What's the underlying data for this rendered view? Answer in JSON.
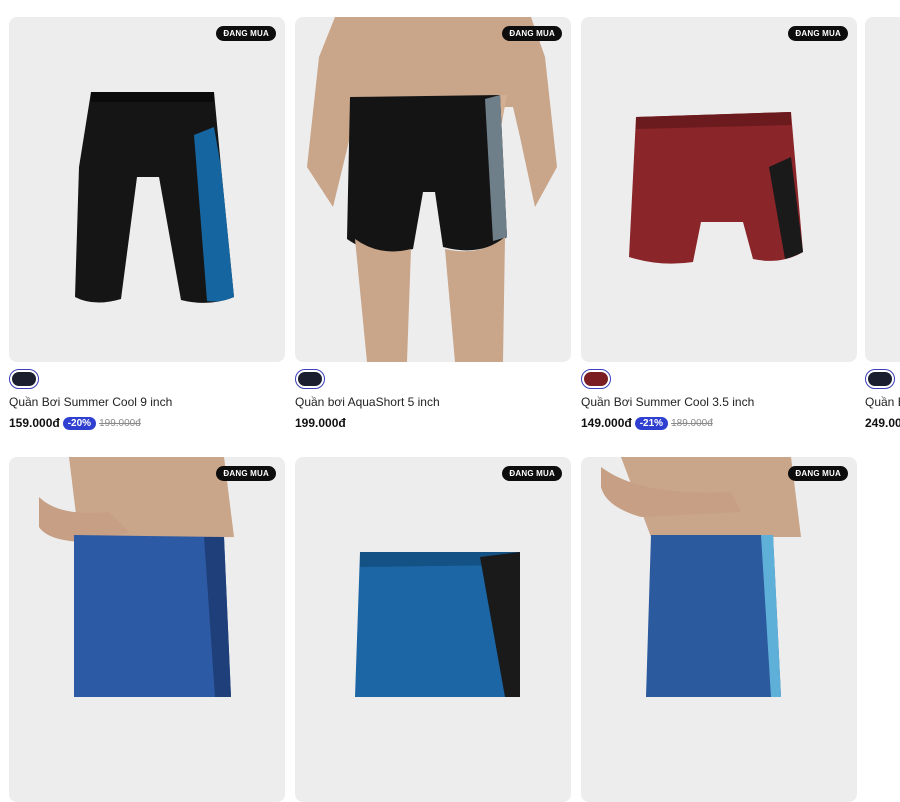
{
  "badge_label": "ĐANG MUA",
  "products": [
    {
      "name": "Quần Bơi Summer Cool 9 inch",
      "price": "159.000đ",
      "discount": "-20%",
      "original_price": "199.000đ",
      "swatch_color": "#1b1e2e",
      "badge": "ĐANG MUA"
    },
    {
      "name": "Quần bơi AquaShort 5 inch",
      "price": "199.000đ",
      "swatch_color": "#1b1e2e",
      "badge": "ĐANG MUA"
    },
    {
      "name": "Quần Bơi Summer Cool 3.5 inch",
      "price": "149.000đ",
      "discount": "-21%",
      "original_price": "189.000đ",
      "swatch_color": "#7a1e22",
      "badge": "ĐANG MUA"
    },
    {
      "name": "Quần B",
      "price": "249.00",
      "swatch_color": "#1b1e2e"
    }
  ],
  "row2_products": [
    {
      "badge": "ĐANG MUA"
    },
    {
      "badge": "ĐANG MUA"
    },
    {
      "badge": "ĐANG MUA"
    }
  ],
  "colors": {
    "accent": "#2f3fd0",
    "badge_bg": "#0d0d0d",
    "card_bg": "#ededed"
  }
}
